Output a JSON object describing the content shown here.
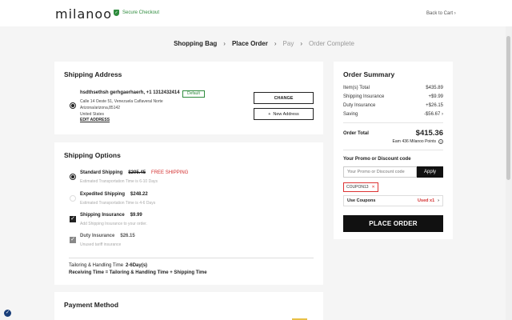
{
  "header": {
    "logo": "milanoo",
    "secure_checkout": "Secure Checkout",
    "back_to_cart": "Back to Cart"
  },
  "steps": [
    {
      "label": "Shopping Bag",
      "state": "active"
    },
    {
      "label": "Place Order",
      "state": "active"
    },
    {
      "label": "Pay",
      "state": "inactive"
    },
    {
      "label": "Order Complete",
      "state": "inactive"
    }
  ],
  "shipping_address": {
    "title": "Shipping Address",
    "name_phone": "hsdthsethsh gerhgaerhaerh, +1 1312432414",
    "default_badge": "Default",
    "line1": "Calle 14 Oeste 51, Venezuela Caflaveral Norte",
    "line2": "Arizona/arizona,85142",
    "country": "United States",
    "edit_label": "EDIT ADDRESS",
    "change_label": "CHANGE",
    "new_address_label": "New Address"
  },
  "shipping_options": {
    "title": "Shipping Options",
    "standard": {
      "label": "Standard Shipping",
      "price": "$205.45",
      "free": "FREE SHIPPING",
      "estimate": "Estimated Transportation Time is 6-10 Days"
    },
    "expedited": {
      "label": "Expedited Shipping",
      "price": "$248.22",
      "estimate": "Estimated Transportation Time is 4-6 Days"
    },
    "insurance": {
      "label": "Shipping Insurance",
      "price": "$9.99",
      "note": "Add Shipping Insurance to your order."
    },
    "duty": {
      "label": "Duty Insurance",
      "price": "$26.15",
      "note": "Unused tariff insurance"
    },
    "handling_prefix": "Tailoring & Handling Time",
    "handling_value": "2-6Day(s)",
    "receiving": "Receiving Time = Tailoring & Handling Time + Shipping Time"
  },
  "payment": {
    "title": "Payment Method"
  },
  "summary": {
    "title": "Order Summary",
    "rows": [
      {
        "label": "Item(s) Total",
        "value": "$435.89"
      },
      {
        "label": "Shipping Insurance",
        "value": "+$9.99"
      },
      {
        "label": "Duty Insurance",
        "value": "+$26.15"
      },
      {
        "label": "Saving",
        "value": "-$56.67"
      }
    ],
    "order_total_label": "Order Total",
    "order_total_value": "$415.36",
    "points": "Earn 436 Milanoo Points",
    "promo_title": "Your Promo or Discount code",
    "promo_placeholder": "Your Promo or Discount code",
    "apply_label": "Apply",
    "coupon_code": "COUPON13",
    "use_coupons_label": "Use Coupons",
    "used_count": "Used x1",
    "place_order_label": "PLACE ORDER"
  },
  "colors": {
    "accent": "#111111",
    "free_shipping": "#d32f2f",
    "secure": "#2e8b3d",
    "used": "#d32f2f"
  }
}
